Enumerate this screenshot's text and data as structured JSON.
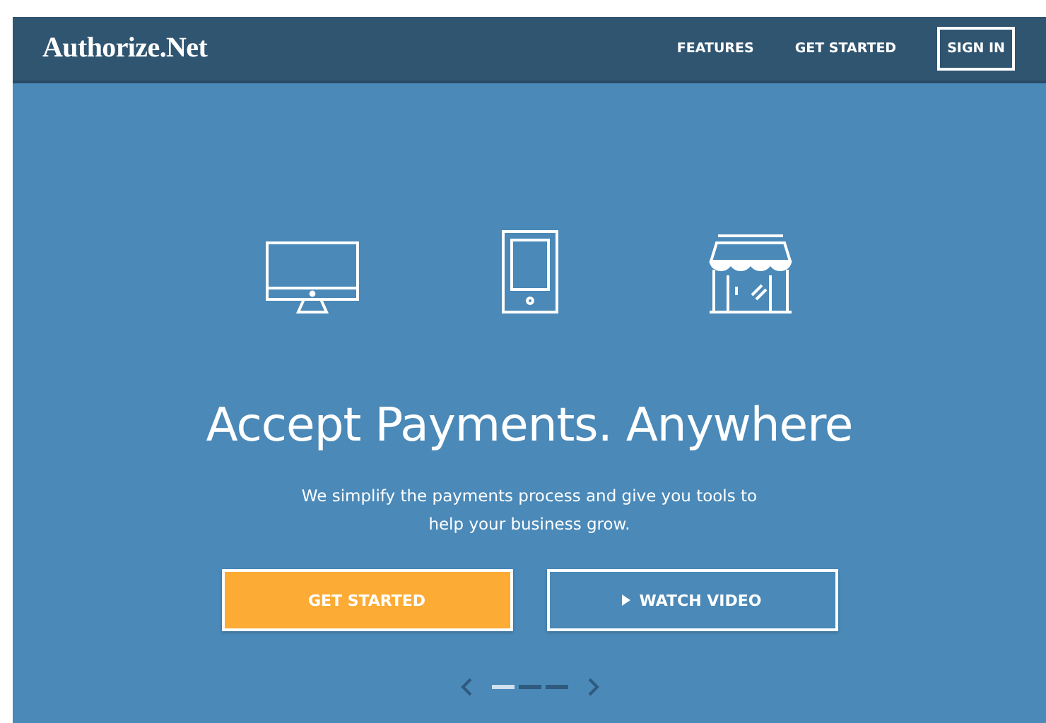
{
  "header": {
    "logo": "Authorize.Net",
    "nav": [
      {
        "label": "FEATURES",
        "kind": "link"
      },
      {
        "label": "GET STARTED",
        "kind": "link"
      },
      {
        "label": "SIGN IN",
        "kind": "outlined"
      }
    ]
  },
  "hero": {
    "headline": "Accept Payments. Anywhere",
    "subtitle": "We simplify the payments process and give you tools to help your business grow.",
    "buttons": [
      {
        "label": "GET STARTED",
        "kind": "primary"
      },
      {
        "label": "WATCH VIDEO",
        "kind": "video"
      }
    ],
    "slides": [
      {
        "selected": true
      },
      {
        "selected": false
      },
      {
        "selected": false
      }
    ]
  }
}
